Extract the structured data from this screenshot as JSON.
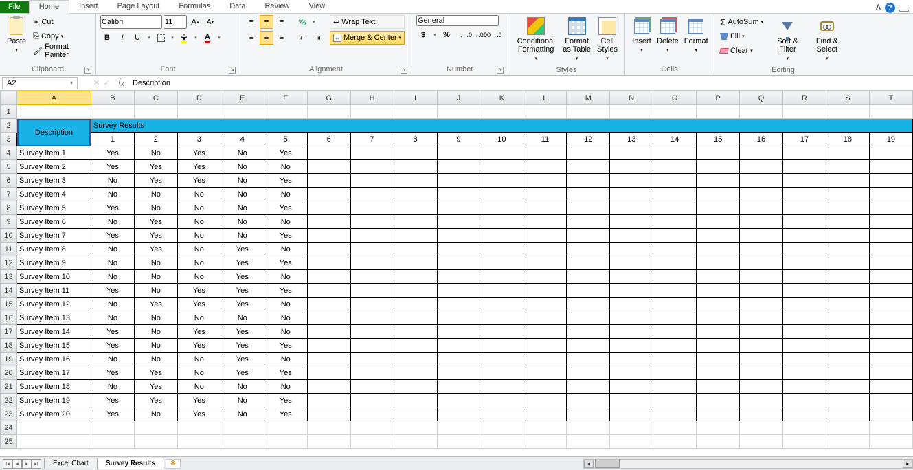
{
  "tabs": {
    "file": "File",
    "list": [
      "Home",
      "Insert",
      "Page Layout",
      "Formulas",
      "Data",
      "Review",
      "View"
    ],
    "active": 0
  },
  "ribbon": {
    "clipboard": {
      "paste": "Paste",
      "cut": "Cut",
      "copy": "Copy",
      "fp": "Format Painter",
      "label": "Clipboard"
    },
    "font": {
      "name": "Calibri",
      "size": "11",
      "label": "Font"
    },
    "alignment": {
      "wrap": "Wrap Text",
      "merge": "Merge & Center",
      "label": "Alignment"
    },
    "number": {
      "format": "General",
      "label": "Number"
    },
    "styles": {
      "cf": "Conditional Formatting",
      "fat": "Format as Table",
      "cs": "Cell Styles",
      "label": "Styles"
    },
    "cells": {
      "ins": "Insert",
      "del": "Delete",
      "fmt": "Format",
      "label": "Cells"
    },
    "editing": {
      "asum": "AutoSum",
      "fill": "Fill",
      "clear": "Clear",
      "sort": "Sort & Filter",
      "find": "Find & Select",
      "label": "Editing"
    }
  },
  "namebox": "A2",
  "formula": "Description",
  "columns": [
    "A",
    "B",
    "C",
    "D",
    "E",
    "F",
    "G",
    "H",
    "I",
    "J",
    "K",
    "L",
    "M",
    "N",
    "O",
    "P",
    "Q",
    "R",
    "S",
    "T"
  ],
  "header_title": "Survey Results",
  "header_desc": "Description",
  "header_nums": [
    "1",
    "2",
    "3",
    "4",
    "5",
    "6",
    "7",
    "8",
    "9",
    "10",
    "11",
    "12",
    "13",
    "14",
    "15",
    "16",
    "17",
    "18",
    "19"
  ],
  "rows": [
    {
      "n": "4",
      "d": "Survey Item 1",
      "v": [
        "Yes",
        "No",
        "Yes",
        "No",
        "Yes"
      ]
    },
    {
      "n": "5",
      "d": "Survey Item 2",
      "v": [
        "Yes",
        "Yes",
        "Yes",
        "No",
        "No"
      ]
    },
    {
      "n": "6",
      "d": "Survey Item 3",
      "v": [
        "No",
        "Yes",
        "Yes",
        "No",
        "Yes"
      ]
    },
    {
      "n": "7",
      "d": "Survey Item 4",
      "v": [
        "No",
        "No",
        "No",
        "No",
        "No"
      ]
    },
    {
      "n": "8",
      "d": "Survey Item 5",
      "v": [
        "Yes",
        "No",
        "No",
        "No",
        "Yes"
      ]
    },
    {
      "n": "9",
      "d": "Survey Item 6",
      "v": [
        "No",
        "Yes",
        "No",
        "No",
        "No"
      ]
    },
    {
      "n": "10",
      "d": "Survey Item 7",
      "v": [
        "Yes",
        "Yes",
        "No",
        "No",
        "Yes"
      ]
    },
    {
      "n": "11",
      "d": "Survey Item 8",
      "v": [
        "No",
        "Yes",
        "No",
        "Yes",
        "No"
      ]
    },
    {
      "n": "12",
      "d": "Survey Item 9",
      "v": [
        "No",
        "No",
        "No",
        "Yes",
        "Yes"
      ]
    },
    {
      "n": "13",
      "d": "Survey Item 10",
      "v": [
        "No",
        "No",
        "No",
        "Yes",
        "No"
      ]
    },
    {
      "n": "14",
      "d": "Survey Item 11",
      "v": [
        "Yes",
        "No",
        "Yes",
        "Yes",
        "Yes"
      ]
    },
    {
      "n": "15",
      "d": "Survey Item 12",
      "v": [
        "No",
        "Yes",
        "Yes",
        "Yes",
        "No"
      ]
    },
    {
      "n": "16",
      "d": "Survey Item 13",
      "v": [
        "No",
        "No",
        "No",
        "No",
        "No"
      ]
    },
    {
      "n": "17",
      "d": "Survey Item 14",
      "v": [
        "Yes",
        "No",
        "Yes",
        "Yes",
        "No"
      ]
    },
    {
      "n": "18",
      "d": "Survey Item 15",
      "v": [
        "Yes",
        "No",
        "Yes",
        "Yes",
        "Yes"
      ]
    },
    {
      "n": "19",
      "d": "Survey Item 16",
      "v": [
        "No",
        "No",
        "No",
        "Yes",
        "No"
      ]
    },
    {
      "n": "20",
      "d": "Survey Item 17",
      "v": [
        "Yes",
        "Yes",
        "No",
        "Yes",
        "Yes"
      ]
    },
    {
      "n": "21",
      "d": "Survey Item 18",
      "v": [
        "No",
        "Yes",
        "No",
        "No",
        "No"
      ]
    },
    {
      "n": "22",
      "d": "Survey Item 19",
      "v": [
        "Yes",
        "Yes",
        "Yes",
        "No",
        "Yes"
      ]
    },
    {
      "n": "23",
      "d": "Survey Item 20",
      "v": [
        "Yes",
        "No",
        "Yes",
        "No",
        "Yes"
      ]
    }
  ],
  "empty_rows": [
    "24",
    "25"
  ],
  "sheets": {
    "list": [
      "Excel Chart",
      "Survey Results"
    ],
    "active": 1
  }
}
